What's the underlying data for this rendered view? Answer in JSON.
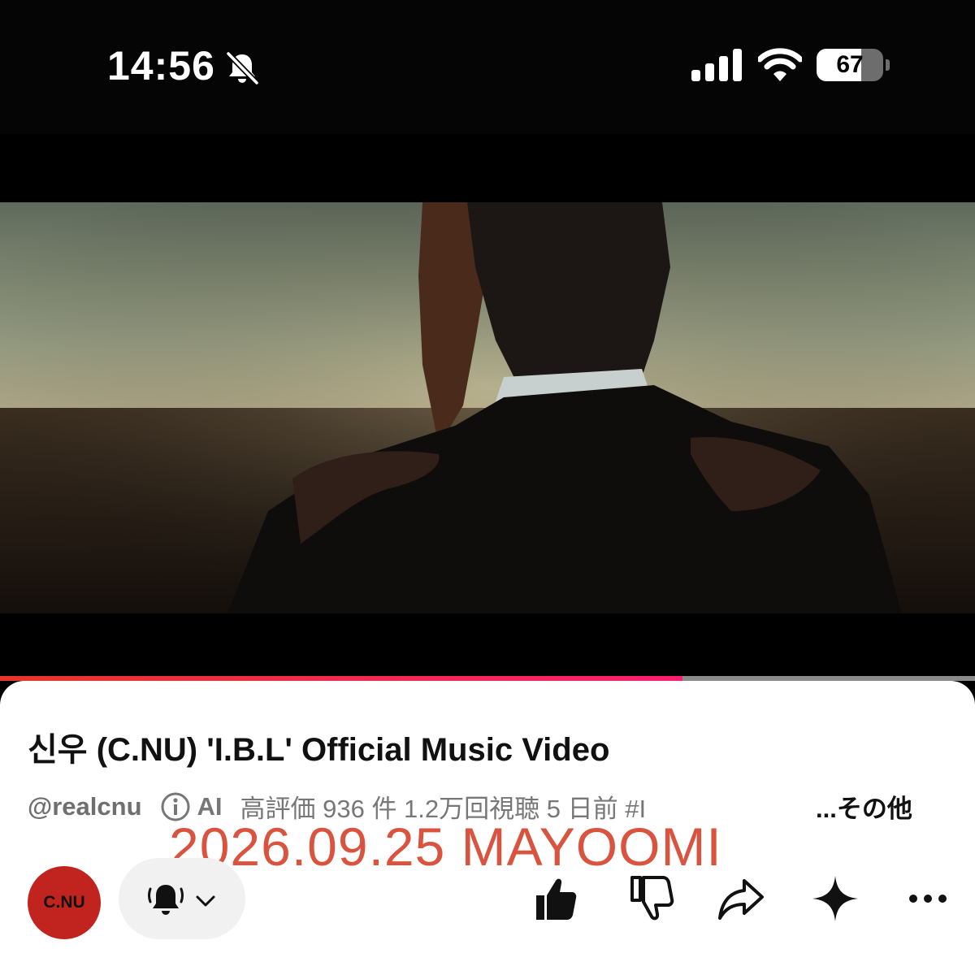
{
  "status_bar": {
    "time": "14:56",
    "battery_level": "67",
    "battery_fraction": 0.67,
    "icons": [
      "bell-slash-icon",
      "signal-bars-icon",
      "wifi-icon",
      "battery-icon"
    ]
  },
  "player": {
    "progress_fraction": 0.7
  },
  "video": {
    "title": "신우 (C.NU) 'I.B.L' Official Music Video",
    "channel_handle": "@realcnu",
    "ai_label": "AI",
    "stats": "高評価 936 件  1.2万回視聴  5 日前  #I",
    "more_label": "...その他"
  },
  "watermark": "2026.09.25 MAYOOMI",
  "channel": {
    "avatar_text": "C.NU",
    "avatar_color": "#c1241f"
  },
  "actions": [
    "thumbs-up-icon",
    "thumbs-down-icon",
    "share-icon",
    "sparkle-icon",
    "more-icon"
  ],
  "colors": {
    "progress": "#e8352b",
    "watermark": "#d9533f"
  }
}
